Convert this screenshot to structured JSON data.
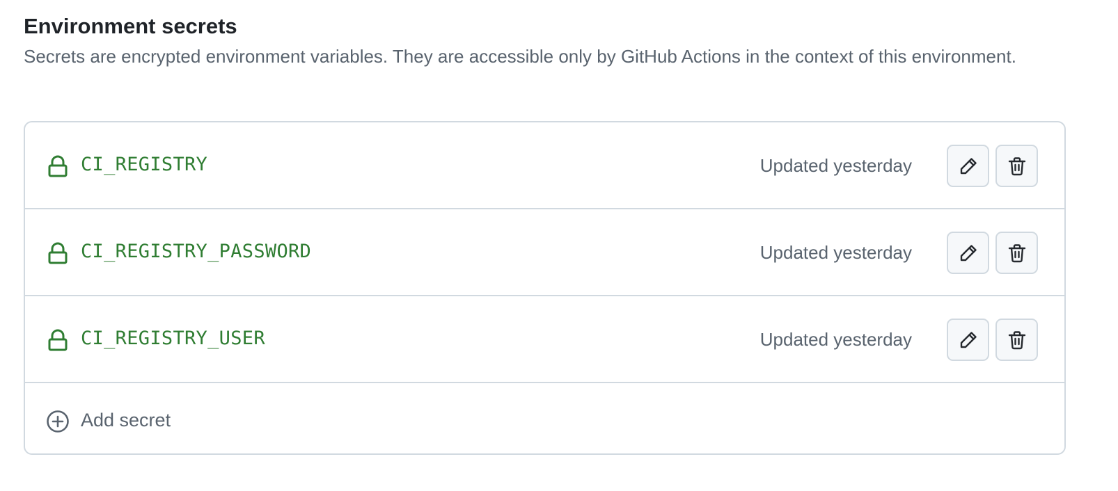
{
  "section": {
    "title": "Environment secrets",
    "description": "Secrets are encrypted environment variables. They are accessible only by GitHub Actions in the context of this environment."
  },
  "secrets": [
    {
      "name": "CI_REGISTRY",
      "updated": "Updated yesterday",
      "icon": "lock-icon"
    },
    {
      "name": "CI_REGISTRY_PASSWORD",
      "updated": "Updated yesterday",
      "icon": "lock-icon"
    },
    {
      "name": "CI_REGISTRY_USER",
      "updated": "Updated yesterday",
      "icon": "lock-icon"
    }
  ],
  "actions": {
    "edit_icon": "pencil-icon",
    "delete_icon": "trash-icon"
  },
  "add_secret": {
    "label": "Add secret",
    "icon": "plus-circle-icon"
  },
  "colors": {
    "secret_name": "#2f7d32",
    "muted_text": "#59636e",
    "border": "#d1d9e0",
    "button_bg": "#f6f8fa"
  }
}
